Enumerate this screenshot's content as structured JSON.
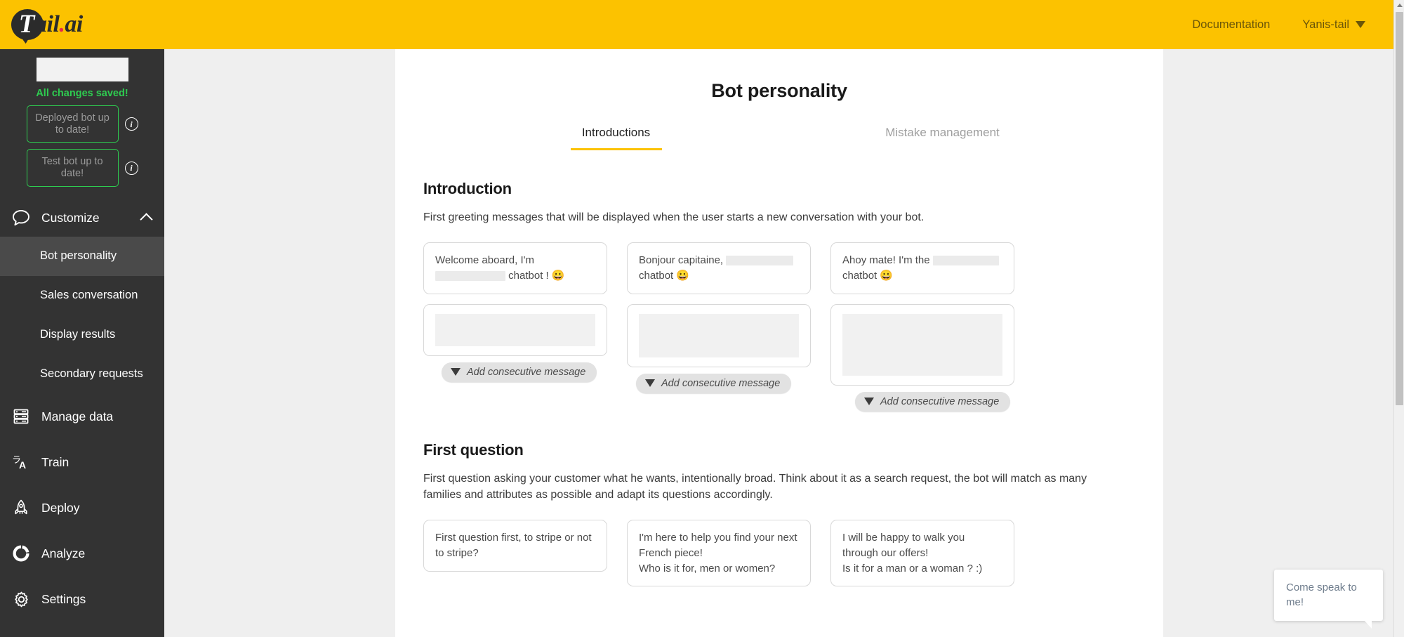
{
  "header": {
    "logo_text_t": "T",
    "logo_text_rest": "ail",
    "logo_dot": ".",
    "logo_suffix": "ai",
    "documentation_label": "Documentation",
    "user_label": "Yanis-tail",
    "brand_color": "#FCC200"
  },
  "sidebar": {
    "bot_name_value": "",
    "saved_status": "All changes saved!",
    "deployed_status": "Deployed bot up to date!",
    "test_status": "Test bot up to date!",
    "info_glyph": "i",
    "status_color": "#2ecc50",
    "group": {
      "label": "Customize",
      "items": [
        {
          "label": "Bot personality",
          "active": true
        },
        {
          "label": "Sales conversation",
          "active": false
        },
        {
          "label": "Display results",
          "active": false
        },
        {
          "label": "Secondary requests",
          "active": false
        }
      ]
    },
    "nav": [
      {
        "label": "Manage data",
        "icon": "database-icon"
      },
      {
        "label": "Train",
        "icon": "translate-icon"
      },
      {
        "label": "Deploy",
        "icon": "rocket-icon"
      },
      {
        "label": "Analyze",
        "icon": "donut-chart-icon"
      },
      {
        "label": "Settings",
        "icon": "gear-icon"
      }
    ]
  },
  "main": {
    "title": "Bot personality",
    "tabs": [
      {
        "label": "Introductions",
        "active": true
      },
      {
        "label": "Mistake management",
        "active": false
      }
    ],
    "introduction": {
      "heading": "Introduction",
      "description": "First greeting messages that will be displayed when the user starts a new conversation with your bot.",
      "columns": [
        {
          "message_part1": "Welcome aboard, I'm",
          "message_redacted_width": 100,
          "message_part2": "chatbot ! 😀",
          "second_block_height": 46,
          "second_block_width": 194,
          "add_label": "Add consecutive message"
        },
        {
          "message_part1": "Bonjour capitaine,",
          "message_redacted_width": 96,
          "message_part2": "chatbot 😀",
          "second_block_height": 62,
          "second_block_width": 196,
          "add_label": "Add consecutive message"
        },
        {
          "message_part1": "Ahoy mate! I'm the",
          "message_redacted_width": 94,
          "message_part2": "chatbot 😀",
          "second_block_height": 88,
          "second_block_width": 196,
          "add_label": "Add consecutive message"
        }
      ]
    },
    "first_question": {
      "heading": "First question",
      "description": "First question asking your customer what he wants, intentionally broad. Think about it as a search request, the bot will match as many families and attributes as possible and adapt its questions accordingly.",
      "columns": [
        {
          "message": "First question first, to stripe or not to stripe?"
        },
        {
          "message": "I'm here to help you find your next French piece!\nWho is it for, men or women?"
        },
        {
          "message": "I will be happy to walk you through our offers!\nIs it for a man or a woman ? :)"
        }
      ]
    }
  },
  "chat_widget": {
    "message": "Come speak to me!"
  }
}
